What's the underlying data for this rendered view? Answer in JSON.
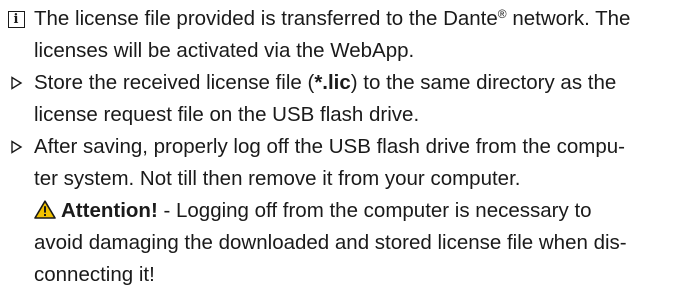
{
  "note": {
    "icon": "info-icon",
    "line1_pre": "The license file provided is transferred to the Dante",
    "line1_sup": "®",
    "line1_post": " network. The",
    "line2": "licenses will be activated via the WebApp."
  },
  "steps": [
    {
      "icon": "step-triangle-icon",
      "line1_pre": "Store the received license file (",
      "line1_bold": "*.lic",
      "line1_post": ") to the same directory as the",
      "line2": "license request file on the USB flash drive."
    },
    {
      "icon": "step-triangle-icon",
      "line1": "After saving, properly log off the USB flash drive from the compu-",
      "line2": "ter system. Not till then remove it from your computer.",
      "warning": {
        "icon": "warning-triangle-icon",
        "label": "Attention!",
        "line1_post": " - Logging off from the computer is necessary to",
        "line2": "avoid damaging the downloaded and stored license file when dis-",
        "line3": "connecting it!"
      }
    }
  ],
  "colors": {
    "text": "#1a1a1a",
    "warning_fill": "#f2c200",
    "warning_stroke": "#1a1a1a"
  }
}
